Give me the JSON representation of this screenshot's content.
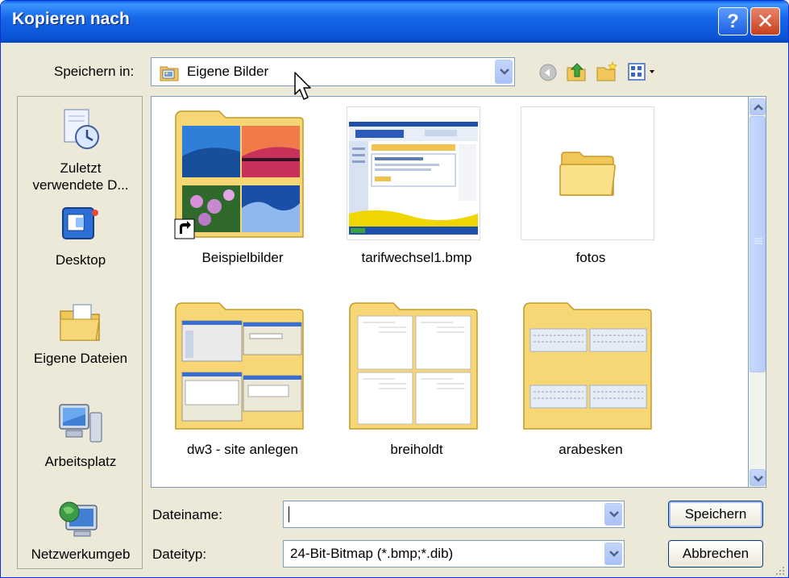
{
  "window": {
    "title": "Kopieren nach",
    "help_label": "?",
    "close_label": "✕"
  },
  "save_in": {
    "label": "Speichern in:",
    "value": "Eigene Bilder"
  },
  "toolbar": {
    "icons": [
      "back-icon",
      "up-folder-icon",
      "new-folder-icon",
      "view-menu-icon"
    ]
  },
  "places": [
    {
      "label": "Zuletzt\nverwendete D...",
      "icon": "recent-documents-icon"
    },
    {
      "label": "Desktop",
      "icon": "desktop-icon"
    },
    {
      "label": "Eigene Dateien",
      "icon": "my-documents-icon"
    },
    {
      "label": "Arbeitsplatz",
      "icon": "my-computer-icon"
    },
    {
      "label": "Netzwerkumgeb",
      "icon": "network-icon"
    }
  ],
  "files": [
    {
      "name": "Beispielbilder",
      "type": "folder-shortcut"
    },
    {
      "name": "tarifwechsel1.bmp",
      "type": "image"
    },
    {
      "name": "fotos",
      "type": "folder"
    },
    {
      "name": "dw3 - site anlegen",
      "type": "folder"
    },
    {
      "name": "breiholdt",
      "type": "folder"
    },
    {
      "name": "arabesken",
      "type": "folder"
    }
  ],
  "filename": {
    "label": "Dateiname:",
    "value": ""
  },
  "filetype": {
    "label": "Dateityp:",
    "value": "24-Bit-Bitmap (*.bmp;*.dib)"
  },
  "buttons": {
    "save": "Speichern",
    "cancel": "Abbrechen"
  },
  "colors": {
    "title_bar": "#0a54d6",
    "folder": "#f7d775",
    "dialog_bg": "#ece9d8"
  }
}
